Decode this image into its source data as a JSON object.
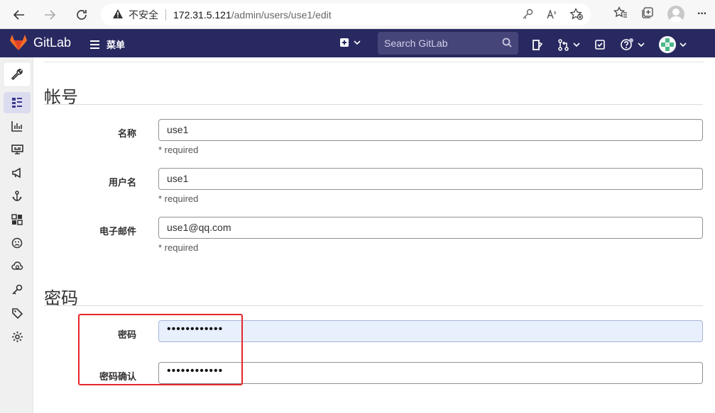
{
  "browser": {
    "security_text": "不安全",
    "url_host": "172.31.5.121",
    "url_path": "/admin/users/use1/edit",
    "more": "···"
  },
  "navbar": {
    "brand": "GitLab",
    "menu_label": "菜单",
    "search_placeholder": "Search GitLab",
    "accent": "#292961"
  },
  "account_section": {
    "title": "帐号",
    "fields": [
      {
        "label": "名称",
        "value": "use1",
        "help": "* required"
      },
      {
        "label": "用户名",
        "value": "use1",
        "help": "* required"
      },
      {
        "label": "电子邮件",
        "value": "use1@qq.com",
        "help": "* required"
      }
    ]
  },
  "password_section": {
    "title": "密码",
    "fields": [
      {
        "label": "密码",
        "value": "••••••••••••"
      },
      {
        "label": "密码确认",
        "value": "••••••••••••"
      }
    ]
  },
  "highlight_color": "#e3262a"
}
